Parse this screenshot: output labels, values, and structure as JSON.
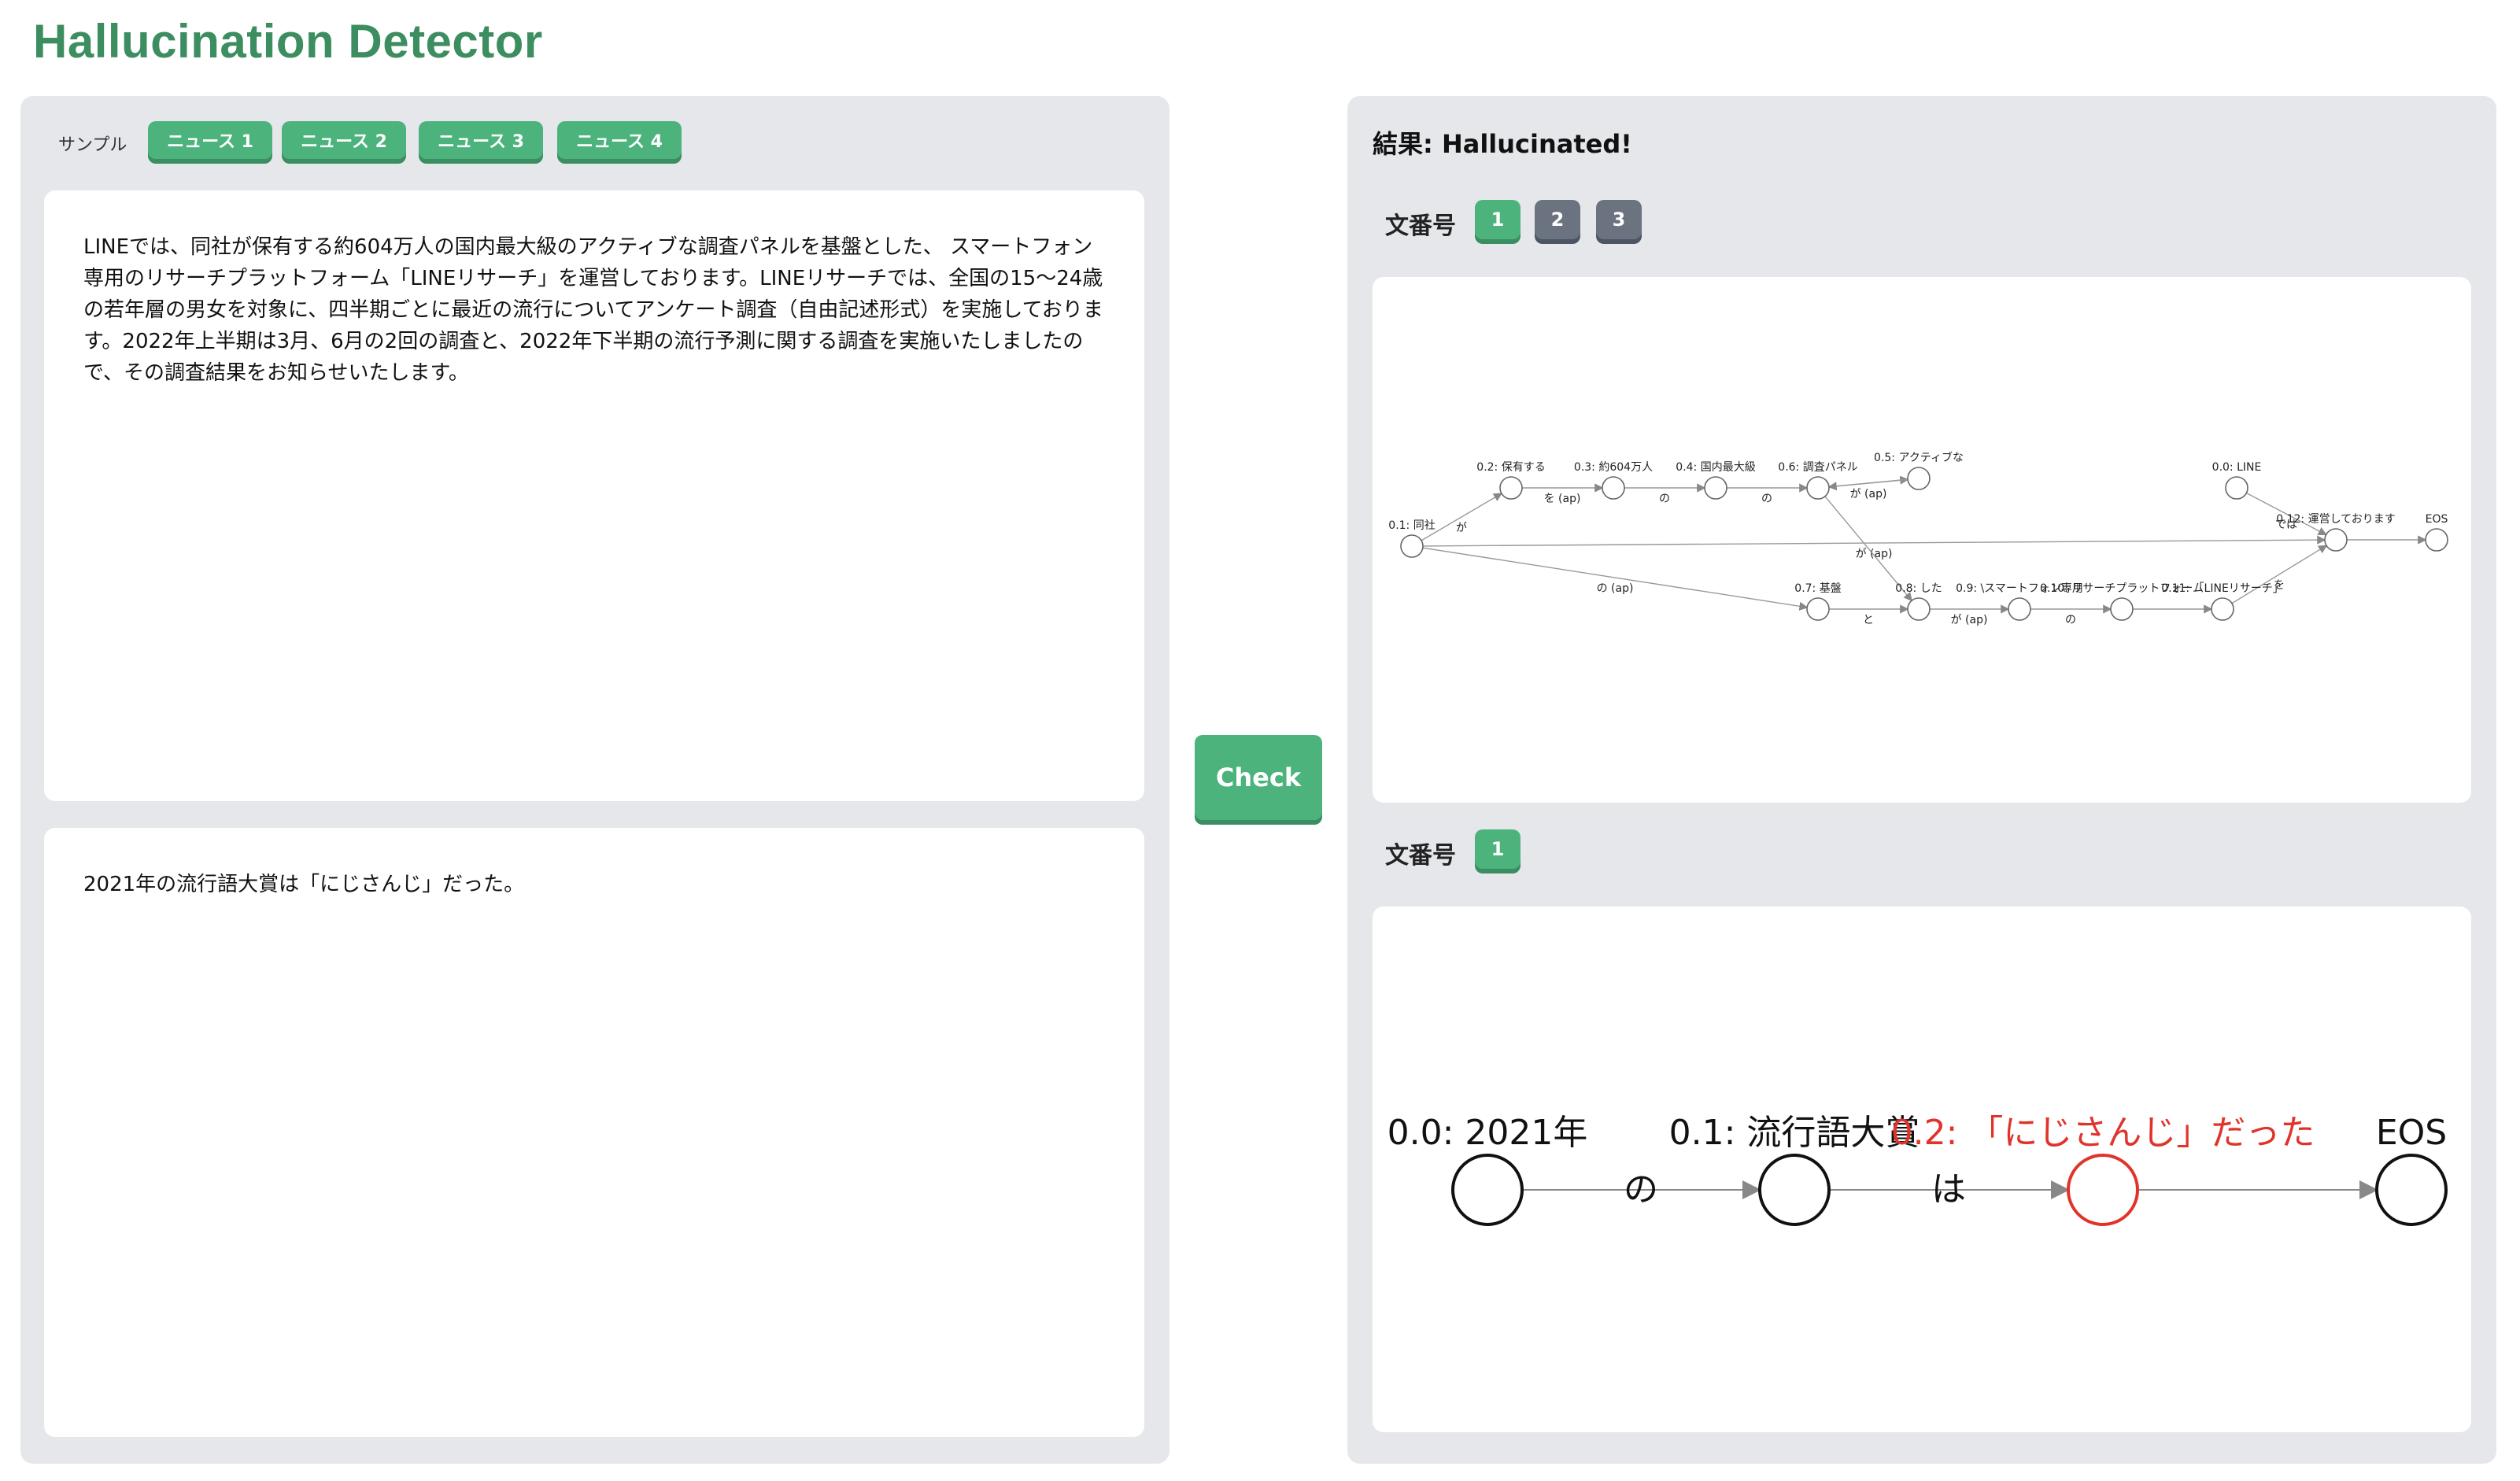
{
  "app": {
    "title": "Hallucination Detector"
  },
  "samples": {
    "label": "サンプル",
    "buttons": [
      "ニュース 1",
      "ニュース 2",
      "ニュース 3",
      "ニュース 4"
    ]
  },
  "source_text": "LINEでは、同社が保有する約604万人の国内最大級のアクティブな調査パネルを基盤とした、 スマートフォン専用のリサーチプラットフォーム「LINEリサーチ」を運営しております。LINEリサーチでは、全国の15～24歳の若年層の男女を対象に、四半期ごとに最近の流行についてアンケート調査（自由記述形式）を実施しております。2022年上半期は3月、6月の2回の調査と、2022年下半期の流行予測に関する調査を実施いたしましたので、その調査結果をお知らせいたします。",
  "claim_text": "2021年の流行語大賞は「にじさんじ」だった。",
  "check_label": "Check",
  "result": {
    "label": "結果: Hallucinated!",
    "sentence_label": "文番号",
    "source_sentences": [
      "1",
      "2",
      "3"
    ],
    "claim_sentences": [
      "1"
    ]
  },
  "colors": {
    "green": "#4cb37c",
    "gray": "#6b7280",
    "title_green": "#3c8d5f",
    "hallucinated_red": "#e0342b"
  },
  "graph1": {
    "nodes": [
      {
        "id": "n01",
        "label": "0.1: 同社"
      },
      {
        "id": "n02",
        "label": "0.2: 保有する"
      },
      {
        "id": "n03",
        "label": "0.3: 約604万人"
      },
      {
        "id": "n04",
        "label": "0.4: 国内最大級"
      },
      {
        "id": "n06",
        "label": "0.6: 調査パネル"
      },
      {
        "id": "n05",
        "label": "0.5: アクティブな"
      },
      {
        "id": "n00",
        "label": "0.0: LINE"
      },
      {
        "id": "n12",
        "label": "0.12: 運営しております"
      },
      {
        "id": "eos",
        "label": "EOS"
      },
      {
        "id": "n07",
        "label": "0.7: 基盤"
      },
      {
        "id": "n08",
        "label": "0.8: した"
      },
      {
        "id": "n09",
        "label": "0.9: \\スマートフォン専用"
      },
      {
        "id": "n10",
        "label": "0.10: リサーチプラットフォーム"
      },
      {
        "id": "n11",
        "label": "0.11: 「LINEリサーチ」"
      }
    ],
    "edges": [
      {
        "from": "n01",
        "to": "n02",
        "label": "が"
      },
      {
        "from": "n02",
        "to": "n03",
        "label": "を (ap)"
      },
      {
        "from": "n03",
        "to": "n04",
        "label": "の"
      },
      {
        "from": "n04",
        "to": "n06",
        "label": "の"
      },
      {
        "from": "n06",
        "to": "n05",
        "label": "が (ap)"
      },
      {
        "from": "n05",
        "to": "n06",
        "label": ""
      },
      {
        "from": "n01",
        "to": "n12",
        "label": "が (ap)"
      },
      {
        "from": "n06",
        "to": "n08",
        "label": ""
      },
      {
        "from": "n00",
        "to": "n12",
        "label": "では"
      },
      {
        "from": "n12",
        "to": "eos",
        "label": ""
      },
      {
        "from": "n01",
        "to": "n07",
        "label": "の (ap)"
      },
      {
        "from": "n07",
        "to": "n08",
        "label": "と"
      },
      {
        "from": "n08",
        "to": "n09",
        "label": "が (ap)"
      },
      {
        "from": "n09",
        "to": "n10",
        "label": "の"
      },
      {
        "from": "n10",
        "to": "n11",
        "label": ""
      },
      {
        "from": "n11",
        "to": "n12",
        "label": "を"
      }
    ]
  },
  "graph2": {
    "nodes": [
      {
        "id": "c0",
        "label": "0.0: 2021年",
        "hallucinated": false
      },
      {
        "id": "c1",
        "label": "0.1: 流行語大賞",
        "hallucinated": false
      },
      {
        "id": "c2",
        "label": "0.2: 「にじさんじ」だった",
        "hallucinated": true
      },
      {
        "id": "ceos",
        "label": "EOS",
        "hallucinated": false
      }
    ],
    "edges": [
      {
        "from": "c0",
        "to": "c1",
        "label": "の"
      },
      {
        "from": "c1",
        "to": "c2",
        "label": "は"
      },
      {
        "from": "c2",
        "to": "ceos",
        "label": ""
      }
    ]
  }
}
